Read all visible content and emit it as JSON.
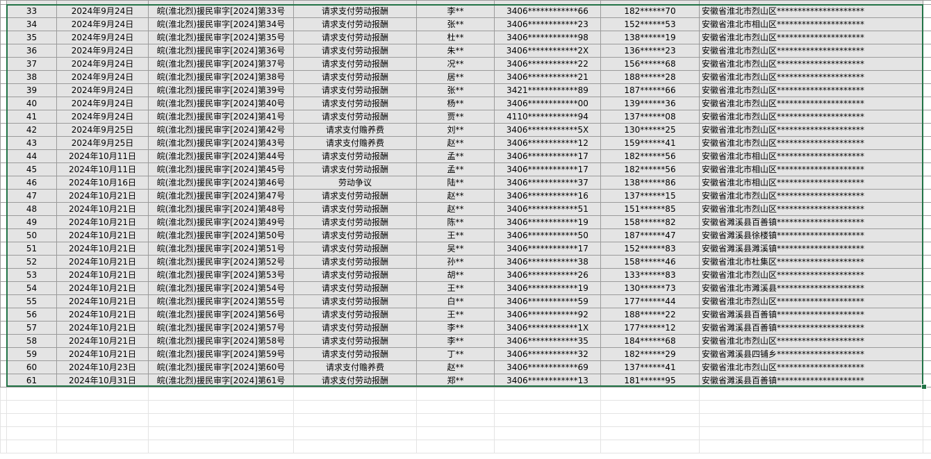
{
  "sheet": {
    "rows": [
      {
        "no": "33",
        "date": "2024年9月24日",
        "case": "皖(淮北烈)援民审字[2024]第33号",
        "type": "请求支付劳动报酬",
        "name": "李**",
        "id": "3406************66",
        "phone": "182******70",
        "addr": "安徽省淮北市烈山区*********************"
      },
      {
        "no": "34",
        "date": "2024年9月24日",
        "case": "皖(淮北烈)援民审字[2024]第34号",
        "type": "请求支付劳动报酬",
        "name": "张**",
        "id": "3406************23",
        "phone": "152******53",
        "addr": "安徽省淮北市相山区*********************"
      },
      {
        "no": "35",
        "date": "2024年9月24日",
        "case": "皖(淮北烈)援民审字[2024]第35号",
        "type": "请求支付劳动报酬",
        "name": "杜**",
        "id": "3406************98",
        "phone": "138******19",
        "addr": "安徽省淮北市烈山区*********************"
      },
      {
        "no": "36",
        "date": "2024年9月24日",
        "case": "皖(淮北烈)援民审字[2024]第36号",
        "type": "请求支付劳动报酬",
        "name": "朱**",
        "id": "3406************2X",
        "phone": "136******23",
        "addr": "安徽省淮北市烈山区*********************"
      },
      {
        "no": "37",
        "date": "2024年9月24日",
        "case": "皖(淮北烈)援民审字[2024]第37号",
        "type": "请求支付劳动报酬",
        "name": "况**",
        "id": "3406************22",
        "phone": "156******68",
        "addr": "安徽省淮北市烈山区*********************"
      },
      {
        "no": "38",
        "date": "2024年9月24日",
        "case": "皖(淮北烈)援民审字[2024]第38号",
        "type": "请求支付劳动报酬",
        "name": "居**",
        "id": "3406************21",
        "phone": "188******28",
        "addr": "安徽省淮北市烈山区*********************"
      },
      {
        "no": "39",
        "date": "2024年9月24日",
        "case": "皖(淮北烈)援民审字[2024]第39号",
        "type": "请求支付劳动报酬",
        "name": "张**",
        "id": "3421************89",
        "phone": "187******66",
        "addr": "安徽省淮北市烈山区*********************"
      },
      {
        "no": "40",
        "date": "2024年9月24日",
        "case": "皖(淮北烈)援民审字[2024]第40号",
        "type": "请求支付劳动报酬",
        "name": "杨**",
        "id": "3406************00",
        "phone": "139******36",
        "addr": "安徽省淮北市烈山区*********************"
      },
      {
        "no": "41",
        "date": "2024年9月24日",
        "case": "皖(淮北烈)援民审字[2024]第41号",
        "type": "请求支付劳动报酬",
        "name": "贾**",
        "id": "4110************94",
        "phone": "137******08",
        "addr": "安徽省淮北市烈山区*********************"
      },
      {
        "no": "42",
        "date": "2024年9月25日",
        "case": "皖(淮北烈)援民审字[2024]第42号",
        "type": "请求支付赡养费",
        "name": "刘**",
        "id": "3406************5X",
        "phone": "130******25",
        "addr": "安徽省淮北市烈山区*********************"
      },
      {
        "no": "43",
        "date": "2024年9月25日",
        "case": "皖(淮北烈)援民审字[2024]第43号",
        "type": "请求支付赡养费",
        "name": "赵**",
        "id": "3406************12",
        "phone": "159******41",
        "addr": "安徽省淮北市烈山区*********************"
      },
      {
        "no": "44",
        "date": "2024年10月11日",
        "case": "皖(淮北烈)援民审字[2024]第44号",
        "type": "请求支付劳动报酬",
        "name": "孟**",
        "id": "3406************17",
        "phone": "182******56",
        "addr": "安徽省淮北市相山区*********************"
      },
      {
        "no": "45",
        "date": "2024年10月11日",
        "case": "皖(淮北烈)援民审字[2024]第45号",
        "type": "请求支付劳动报酬",
        "name": "孟**",
        "id": "3406************17",
        "phone": "182******56",
        "addr": "安徽省淮北市相山区*********************"
      },
      {
        "no": "46",
        "date": "2024年10月16日",
        "case": "皖(淮北烈)援民审字[2024]第46号",
        "type": "劳动争议",
        "name": "陆**",
        "id": "3406************37",
        "phone": "138******86",
        "addr": "安徽省淮北市相山区*********************"
      },
      {
        "no": "47",
        "date": "2024年10月21日",
        "case": "皖(淮北烈)援民审字[2024]第47号",
        "type": "请求支付劳动报酬",
        "name": "赵**",
        "id": "3406************16",
        "phone": "137******15",
        "addr": "安徽省淮北市烈山区*********************"
      },
      {
        "no": "48",
        "date": "2024年10月21日",
        "case": "皖(淮北烈)援民审字[2024]第48号",
        "type": "请求支付劳动报酬",
        "name": "赵**",
        "id": "3406************51",
        "phone": "151******85",
        "addr": "安徽省淮北市烈山区*********************"
      },
      {
        "no": "49",
        "date": "2024年10月21日",
        "case": "皖(淮北烈)援民审字[2024]第49号",
        "type": "请求支付劳动报酬",
        "name": "陈**",
        "id": "3406************19",
        "phone": "158******82",
        "addr": "安徽省濉溪县百善镇*********************"
      },
      {
        "no": "50",
        "date": "2024年10月21日",
        "case": "皖(淮北烈)援民审字[2024]第50号",
        "type": "请求支付劳动报酬",
        "name": "王**",
        "id": "3406************50",
        "phone": "187******47",
        "addr": "安徽省濉溪县徐楼镇*********************"
      },
      {
        "no": "51",
        "date": "2024年10月21日",
        "case": "皖(淮北烈)援民审字[2024]第51号",
        "type": "请求支付劳动报酬",
        "name": "吴**",
        "id": "3406************17",
        "phone": "152******83",
        "addr": "安徽省濉溪县濉溪镇*********************"
      },
      {
        "no": "52",
        "date": "2024年10月21日",
        "case": "皖(淮北烈)援民审字[2024]第52号",
        "type": "请求支付劳动报酬",
        "name": "孙**",
        "id": "3406************38",
        "phone": "158******46",
        "addr": "安徽省淮北市杜集区*********************"
      },
      {
        "no": "53",
        "date": "2024年10月21日",
        "case": "皖(淮北烈)援民审字[2024]第53号",
        "type": "请求支付劳动报酬",
        "name": "胡**",
        "id": "3406************26",
        "phone": "133******83",
        "addr": "安徽省淮北市烈山区*********************"
      },
      {
        "no": "54",
        "date": "2024年10月21日",
        "case": "皖(淮北烈)援民审字[2024]第54号",
        "type": "请求支付劳动报酬",
        "name": "王**",
        "id": "3406************19",
        "phone": "130******73",
        "addr": "安徽省淮北市濉溪县*********************"
      },
      {
        "no": "55",
        "date": "2024年10月21日",
        "case": "皖(淮北烈)援民审字[2024]第55号",
        "type": "请求支付劳动报酬",
        "name": "白**",
        "id": "3406************59",
        "phone": "177******44",
        "addr": "安徽省淮北市烈山区*********************"
      },
      {
        "no": "56",
        "date": "2024年10月21日",
        "case": "皖(淮北烈)援民审字[2024]第56号",
        "type": "请求支付劳动报酬",
        "name": "王**",
        "id": "3406************92",
        "phone": "188******22",
        "addr": "安徽省濉溪县百善镇*********************"
      },
      {
        "no": "57",
        "date": "2024年10月21日",
        "case": "皖(淮北烈)援民审字[2024]第57号",
        "type": "请求支付劳动报酬",
        "name": "李**",
        "id": "3406************1X",
        "phone": "177******12",
        "addr": "安徽省濉溪县百善镇*********************"
      },
      {
        "no": "58",
        "date": "2024年10月21日",
        "case": "皖(淮北烈)援民审字[2024]第58号",
        "type": "请求支付劳动报酬",
        "name": "李**",
        "id": "3406************35",
        "phone": "184******68",
        "addr": "安徽省淮北市烈山区*********************"
      },
      {
        "no": "59",
        "date": "2024年10月21日",
        "case": "皖(淮北烈)援民审字[2024]第59号",
        "type": "请求支付劳动报酬",
        "name": "丁**",
        "id": "3406************32",
        "phone": "182******29",
        "addr": "安徽省濉溪县四铺乡*********************"
      },
      {
        "no": "60",
        "date": "2024年10月23日",
        "case": "皖(淮北烈)援民审字[2024]第60号",
        "type": "请求支付赡养费",
        "name": "赵**",
        "id": "3406************69",
        "phone": "137******41",
        "addr": "安徽省淮北市烈山区*********************"
      },
      {
        "no": "61",
        "date": "2024年10月31日",
        "case": "皖(淮北烈)援民审字[2024]第61号",
        "type": "请求支付劳动报酬",
        "name": "郑**",
        "id": "3406************13",
        "phone": "181******95",
        "addr": "安徽省濉溪县百善镇*********************"
      }
    ],
    "empty_row_count": 5,
    "colors": {
      "selection": "#217346",
      "data_fill": "#e4e4e4"
    }
  }
}
